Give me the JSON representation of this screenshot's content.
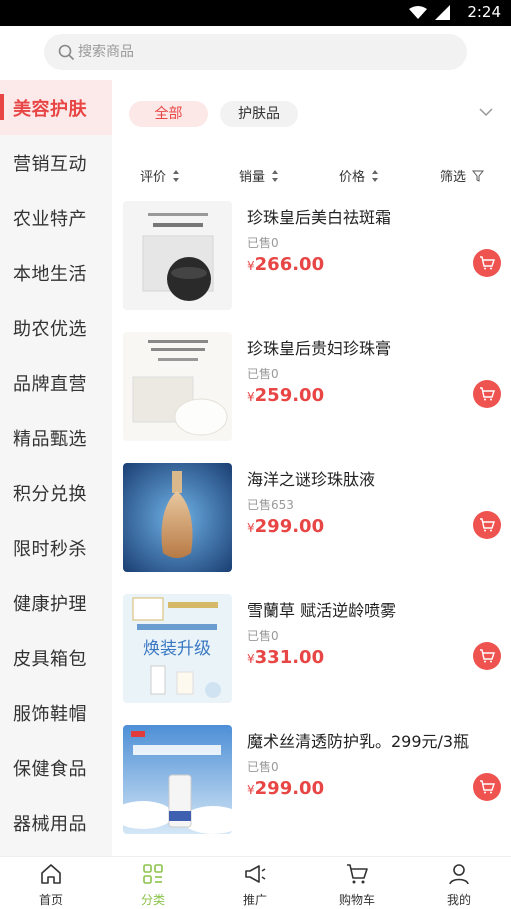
{
  "status_bar": {
    "time": "2:24"
  },
  "search": {
    "placeholder": "搜索商品"
  },
  "sidebar": {
    "items": [
      {
        "label": "美容护肤",
        "active": true
      },
      {
        "label": "营销互动"
      },
      {
        "label": "农业特产"
      },
      {
        "label": "本地生活"
      },
      {
        "label": "助农优选"
      },
      {
        "label": "品牌直营"
      },
      {
        "label": "精品甄选"
      },
      {
        "label": "积分兑换"
      },
      {
        "label": "限时秒杀"
      },
      {
        "label": "健康护理"
      },
      {
        "label": "皮具箱包"
      },
      {
        "label": "服饰鞋帽"
      },
      {
        "label": "保健食品"
      },
      {
        "label": "器械用品"
      }
    ]
  },
  "filters": {
    "chips": [
      "全部",
      "护肤品"
    ],
    "active_chip": "全部"
  },
  "sort": {
    "rating": "评价",
    "sales": "销量",
    "price": "价格",
    "filter": "筛选"
  },
  "products": [
    {
      "name": "珍珠皇后美白祛斑霜",
      "sold": "已售0",
      "currency": "¥",
      "price": "266.00"
    },
    {
      "name": "珍珠皇后贵妇珍珠膏",
      "sold": "已售0",
      "currency": "¥",
      "price": "259.00"
    },
    {
      "name": "海洋之谜珍珠肽液",
      "sold": "已售653",
      "currency": "¥",
      "price": "299.00"
    },
    {
      "name": "雪蘭草 赋活逆龄喷雾",
      "sold": "已售0",
      "currency": "¥",
      "price": "331.00",
      "thumb_text": "焕装升级"
    },
    {
      "name": "魔术丝清透防护乳。299元/3瓶",
      "sold": "已售0",
      "currency": "¥",
      "price": "299.00"
    }
  ],
  "tabbar": {
    "items": [
      {
        "label": "首页",
        "icon": "home-icon"
      },
      {
        "label": "分类",
        "icon": "category-icon",
        "active": true
      },
      {
        "label": "推广",
        "icon": "megaphone-icon"
      },
      {
        "label": "购物车",
        "icon": "cart-icon"
      },
      {
        "label": "我的",
        "icon": "user-icon"
      }
    ]
  },
  "colors": {
    "accent": "#e84545",
    "active_tab": "#8bc34a"
  }
}
